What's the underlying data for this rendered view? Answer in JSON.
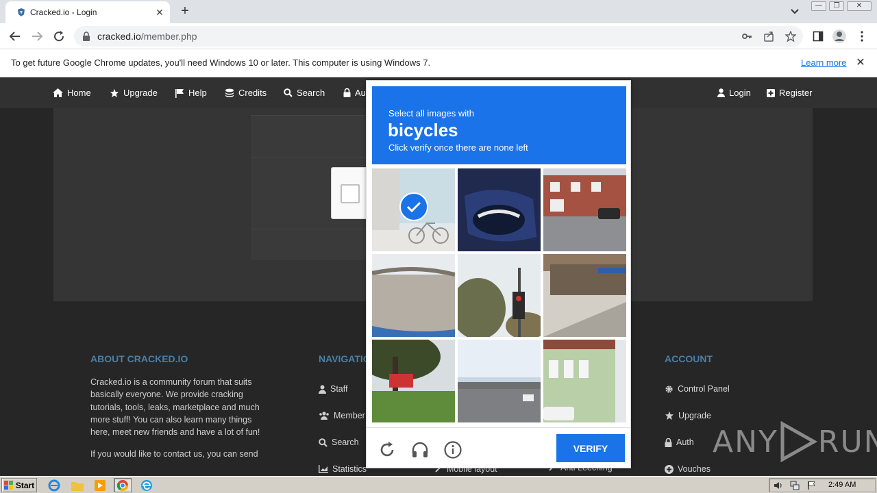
{
  "browser": {
    "tab_title": "Cracked.io - Login",
    "new_tab": "+",
    "close_tab": "✕",
    "window_controls": [
      "—",
      "❐",
      "✕"
    ]
  },
  "toolbar": {
    "url_host": "cracked.io",
    "url_path": "/member.php"
  },
  "infobar": {
    "message": "To get future Google Chrome updates, you'll need Windows 10 or later. This computer is using Windows 7.",
    "learn_more": "Learn more",
    "close": "✕"
  },
  "navbar": {
    "items": [
      {
        "label": "Home",
        "icon": "home-icon"
      },
      {
        "label": "Upgrade",
        "icon": "star-icon"
      },
      {
        "label": "Help",
        "icon": "flag-icon"
      },
      {
        "label": "Credits",
        "icon": "coins-icon"
      },
      {
        "label": "Search",
        "icon": "search-icon"
      },
      {
        "label": "Au",
        "icon": "lock-icon"
      }
    ],
    "right_items": [
      {
        "label": "Login",
        "icon": "user-icon"
      },
      {
        "label": "Register",
        "icon": "plus-square-icon"
      }
    ]
  },
  "footer": {
    "about_title": "ABOUT CRACKED.IO",
    "about_text": "Cracked.io is a community forum that suits basically everyone. We provide cracking tutorials, tools, leaks, marketplace and much more stuff! You can also learn many things here, meet new friends and have a lot of fun!",
    "about_text2": "If you would like to contact us, you can send",
    "nav_title": "NAVIGATIO",
    "nav_links": [
      "Staff",
      "Member",
      "Search",
      "Statistics"
    ],
    "mid_links": [
      "Mobile layout",
      "Anti Leeching"
    ],
    "account_title": "ACCOUNT",
    "account_links": [
      "Control Panel",
      "Upgrade",
      "Auth",
      "Vouches"
    ]
  },
  "captcha": {
    "prompt_pre": "Select all images with",
    "target": "bicycles",
    "prompt_post": "Click verify once there are none left",
    "verify_label": "VERIFY",
    "tiles_selected": [
      true,
      false,
      false,
      false,
      false,
      false,
      false,
      false,
      false
    ],
    "accent_color": "#1a73e8"
  },
  "watermark": {
    "left": "ANY",
    "right": "RUN"
  },
  "taskbar": {
    "start_label": "Start",
    "time": "2:49 AM"
  }
}
